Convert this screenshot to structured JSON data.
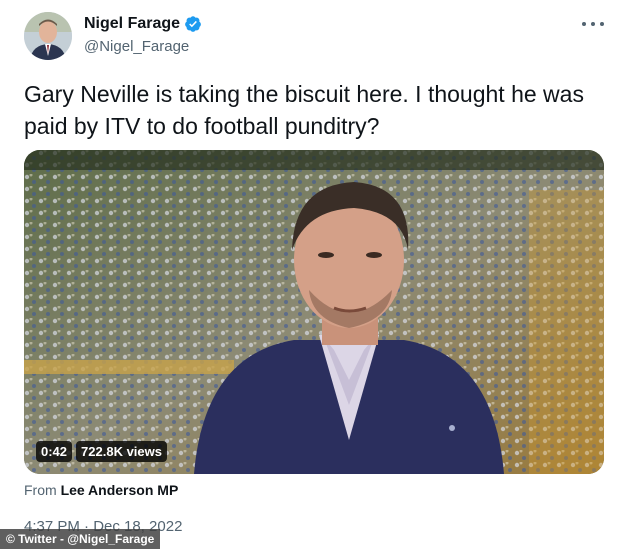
{
  "author": {
    "display_name": "Nigel Farage",
    "handle": "@Nigel_Farage",
    "verified_icon": "verified-badge-icon",
    "verified_color": "#1d9bf0"
  },
  "menu_icon": "more-horizontal-icon",
  "tweet": {
    "text": "Gary Neville is taking the biscuit here. I thought he was paid by ITV to do football punditry?"
  },
  "video": {
    "duration": "0:42",
    "views": "722.8K views"
  },
  "from": {
    "prefix": "From",
    "source": "Lee Anderson MP"
  },
  "timestamp": "4:37 PM · Dec 18, 2022",
  "credit": "© Twitter - @Nigel_Farage"
}
